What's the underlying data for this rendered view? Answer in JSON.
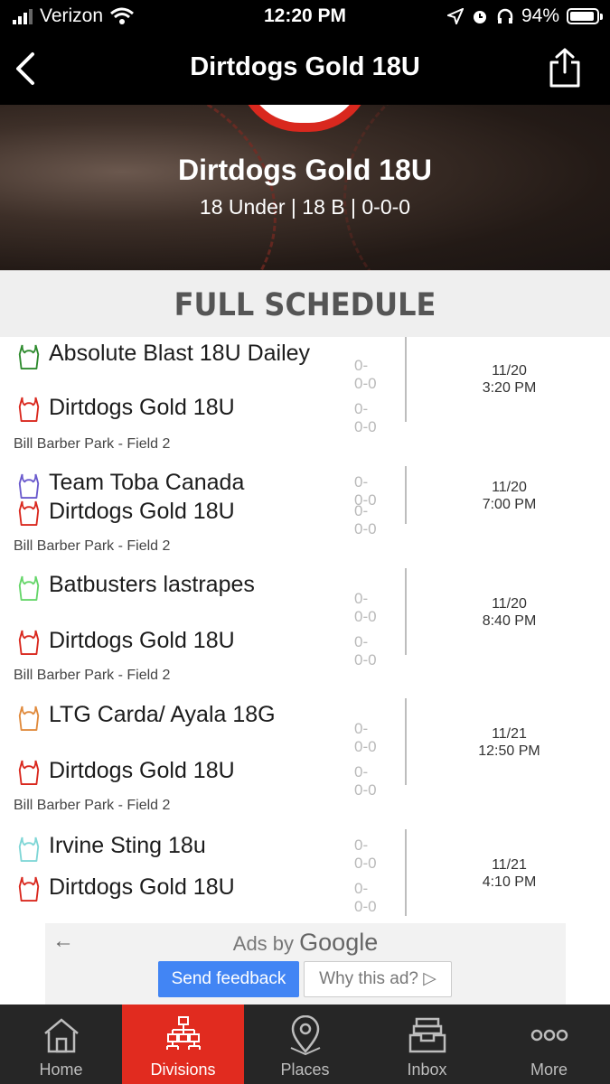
{
  "status": {
    "carrier": "Verizon",
    "time": "12:20 PM",
    "battery": "94%",
    "battery_level": 0.94
  },
  "nav": {
    "title": "Dirtdogs Gold 18U"
  },
  "hero": {
    "team_name": "Dirtdogs Gold 18U",
    "subtitle": "18 Under | 18 B | 0-0-0"
  },
  "schedule": {
    "header": "FULL SCHEDULE",
    "games": [
      {
        "away": {
          "name": "Absolute Blast 18U Dailey",
          "record": "0-0-0",
          "color": "#2e8b2e"
        },
        "home": {
          "name": "Dirtdogs Gold 18U",
          "record": "0-0-0",
          "color": "#d9281e"
        },
        "date": "11/20",
        "time": "3:20 PM",
        "location": "Bill Barber Park - Field 2"
      },
      {
        "away": {
          "name": "Team Toba Canada",
          "record": "0-0-0",
          "color": "#6a5acd"
        },
        "home": {
          "name": "Dirtdogs Gold 18U",
          "record": "0-0-0",
          "color": "#d9281e"
        },
        "date": "11/20",
        "time": "7:00 PM",
        "location": "Bill Barber Park - Field 2"
      },
      {
        "away": {
          "name": "Batbusters lastrapes",
          "record": "0-0-0",
          "color": "#66d66a"
        },
        "home": {
          "name": "Dirtdogs Gold 18U",
          "record": "0-0-0",
          "color": "#d9281e"
        },
        "date": "11/20",
        "time": "8:40 PM",
        "location": "Bill Barber Park - Field 2"
      },
      {
        "away": {
          "name": "LTG Carda/ Ayala 18G",
          "record": "0-0-0",
          "color": "#e08a3c"
        },
        "home": {
          "name": "Dirtdogs Gold 18U",
          "record": "0-0-0",
          "color": "#d9281e"
        },
        "date": "11/21",
        "time": "12:50 PM",
        "location": "Bill Barber Park - Field 2"
      },
      {
        "away": {
          "name": "Irvine Sting 18u",
          "record": "0-0-0",
          "color": "#7fd6d6"
        },
        "home": {
          "name": "Dirtdogs Gold 18U",
          "record": "0-0-0",
          "color": "#d9281e"
        },
        "date": "11/21",
        "time": "4:10 PM",
        "location": ""
      }
    ]
  },
  "ad": {
    "ads_by": "Ads by",
    "google": "Google",
    "send_feedback": "Send feedback",
    "why_this_ad": "Why this ad? ▷"
  },
  "tabs": [
    {
      "label": "Home",
      "icon": "home-icon",
      "active": false
    },
    {
      "label": "Divisions",
      "icon": "divisions-icon",
      "active": true
    },
    {
      "label": "Places",
      "icon": "places-icon",
      "active": false
    },
    {
      "label": "Inbox",
      "icon": "inbox-icon",
      "active": false
    },
    {
      "label": "More",
      "icon": "more-icon",
      "active": false
    }
  ]
}
